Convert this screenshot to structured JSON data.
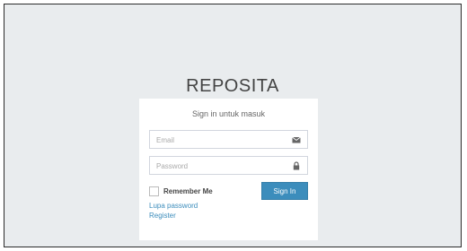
{
  "app": {
    "title": "REPOSITA"
  },
  "login": {
    "subtitle": "Sign in untuk masuk",
    "email_placeholder": "Email",
    "password_placeholder": "Password",
    "remember_label": "Remember Me",
    "sign_in_label": "Sign In",
    "forgot_password_label": "Lupa password",
    "register_label": "Register"
  },
  "icons": {
    "email": "envelope-icon",
    "password": "lock-icon"
  },
  "colors": {
    "primary": "#3c8dbc",
    "background": "#e9ecee",
    "card": "#ffffff"
  }
}
